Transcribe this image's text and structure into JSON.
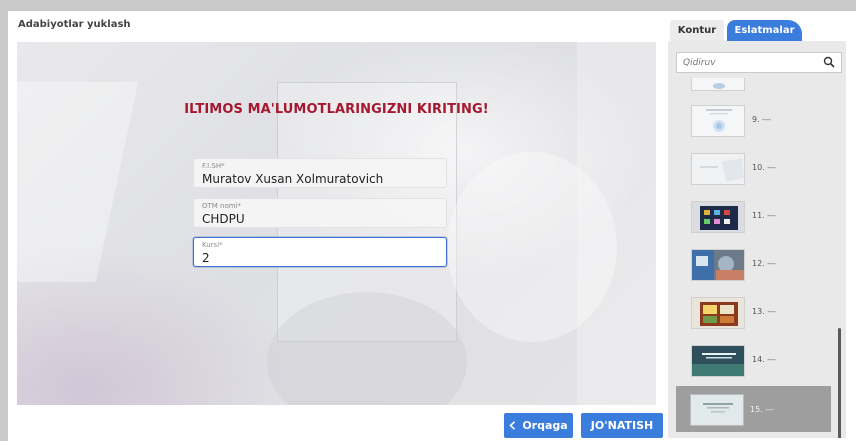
{
  "player": {
    "title": "Adabiyotlar yuklash"
  },
  "form": {
    "heading": "ILTIMOS MA'LUMOTLARINGIZNI KIRITING!",
    "fields": [
      {
        "label": "F.I.SH*",
        "value": "Muratov Xusan Xolmuratovich"
      },
      {
        "label": "OTM nomi*",
        "value": "CHDPU"
      },
      {
        "label": "Kursi*",
        "value": "2"
      }
    ]
  },
  "nav": {
    "back_label": "Orqaga",
    "submit_label": "JO'NATISH"
  },
  "sidebar": {
    "tabs": [
      {
        "label": "Kontur",
        "active": false
      },
      {
        "label": "Eslatmalar",
        "active": true
      }
    ],
    "search": {
      "placeholder": "Qidiruv"
    },
    "slides": [
      {
        "number": "9. ---"
      },
      {
        "number": "10. ---"
      },
      {
        "number": "11. ---"
      },
      {
        "number": "12. ---"
      },
      {
        "number": "13. ---"
      },
      {
        "number": "14. ---"
      },
      {
        "number": "15. ---",
        "active": true
      }
    ]
  },
  "colors": {
    "accent": "#3b7ddd",
    "heading": "#a5182f",
    "active_row": "#9e9e9e"
  }
}
